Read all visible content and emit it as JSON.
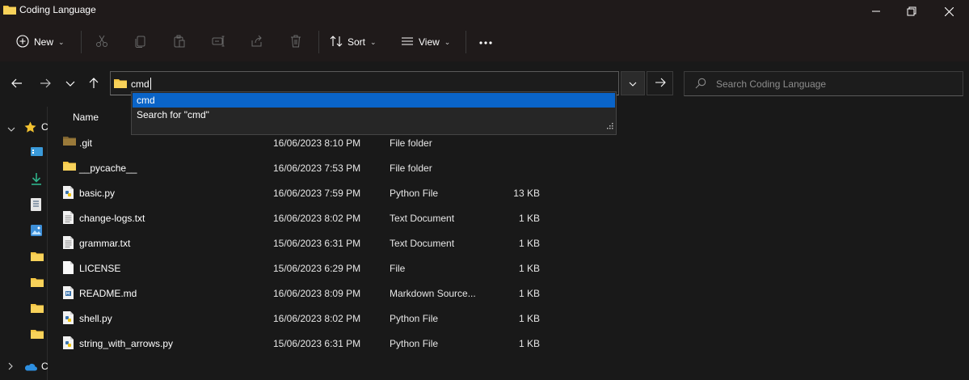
{
  "window": {
    "title": "Coding Language"
  },
  "toolbar": {
    "new_label": "New",
    "sort_label": "Sort",
    "view_label": "View"
  },
  "address": {
    "value": "cmd"
  },
  "search": {
    "placeholder": "Search Coding Language"
  },
  "autocomplete": [
    {
      "label": "cmd",
      "selected": true
    },
    {
      "label": "Search for \"cmd\"",
      "selected": false
    }
  ],
  "columns": {
    "name": "Name"
  },
  "sidebar": {
    "items": [
      {
        "icon": "star-icon",
        "label": "C"
      },
      {
        "icon": "onedrive-cloud-icon",
        "label": "C"
      }
    ]
  },
  "files": [
    {
      "name": ".git",
      "date": "16/06/2023 8:10 PM",
      "type": "File folder",
      "size": "",
      "icon": "folder-dark"
    },
    {
      "name": "__pycache__",
      "date": "16/06/2023 7:53 PM",
      "type": "File folder",
      "size": "",
      "icon": "folder"
    },
    {
      "name": "basic.py",
      "date": "16/06/2023 7:59 PM",
      "type": "Python File",
      "size": "13 KB",
      "icon": "python"
    },
    {
      "name": "change-logs.txt",
      "date": "16/06/2023 8:02 PM",
      "type": "Text Document",
      "size": "1 KB",
      "icon": "text"
    },
    {
      "name": "grammar.txt",
      "date": "15/06/2023 6:31 PM",
      "type": "Text Document",
      "size": "1 KB",
      "icon": "text"
    },
    {
      "name": "LICENSE",
      "date": "15/06/2023 6:29 PM",
      "type": "File",
      "size": "1 KB",
      "icon": "blank"
    },
    {
      "name": "README.md",
      "date": "16/06/2023 8:09 PM",
      "type": "Markdown Source...",
      "size": "1 KB",
      "icon": "markdown"
    },
    {
      "name": "shell.py",
      "date": "16/06/2023 8:02 PM",
      "type": "Python File",
      "size": "1 KB",
      "icon": "python"
    },
    {
      "name": "string_with_arrows.py",
      "date": "15/06/2023 6:31 PM",
      "type": "Python File",
      "size": "1 KB",
      "icon": "python"
    }
  ],
  "colors": {
    "accent": "#0a64c8",
    "folder": "#f4c542",
    "folder_dark": "#9a7a3a"
  }
}
